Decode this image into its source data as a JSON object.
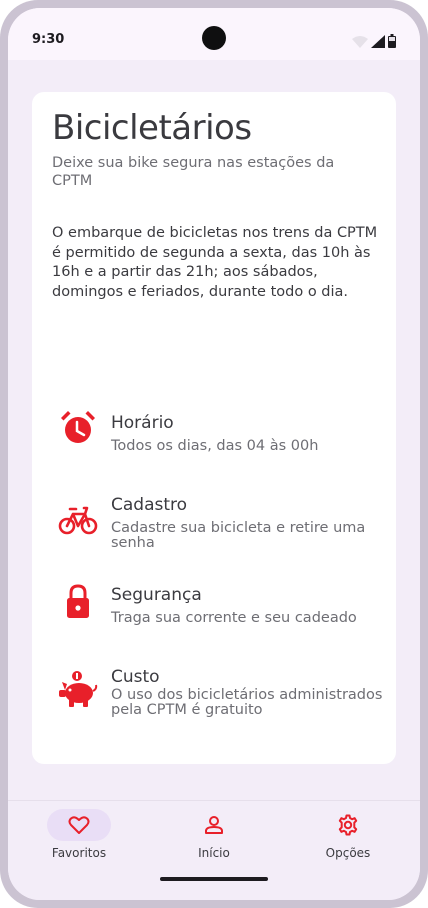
{
  "status_bar": {
    "time": "9:30"
  },
  "header": {
    "title": "Bicicletários",
    "subtitle": "Deixe sua bike segura nas estações da CPTM"
  },
  "intro": "O embarque de bicicletas nos trens da CPTM é permitido de segunda a sexta, das 10h às 16h e a partir das 21h; aos sábados, domingos e feriados, durante todo o dia.",
  "items": [
    {
      "title": "Horário",
      "description": "Todos os dias, das 04 às 00h",
      "icon": "alarm-clock-icon"
    },
    {
      "title": "Cadastro",
      "description": "Cadastre sua bicicleta e retire uma senha",
      "icon": "bicycle-icon"
    },
    {
      "title": "Segurança",
      "description": "Traga sua corrente e seu cadeado",
      "icon": "lock-icon"
    },
    {
      "title": "Custo",
      "description": "O uso dos bicicletários administrados pela CPTM é gratuito",
      "icon": "piggy-bank-icon"
    }
  ],
  "nav": {
    "favoritos": "Favoritos",
    "inicio": "Início",
    "opcoes": "Opções"
  },
  "colors": {
    "accent": "#e8202a",
    "background": "#f3edf8",
    "card": "#ffffff",
    "nav_active_pill": "#e9def6"
  }
}
